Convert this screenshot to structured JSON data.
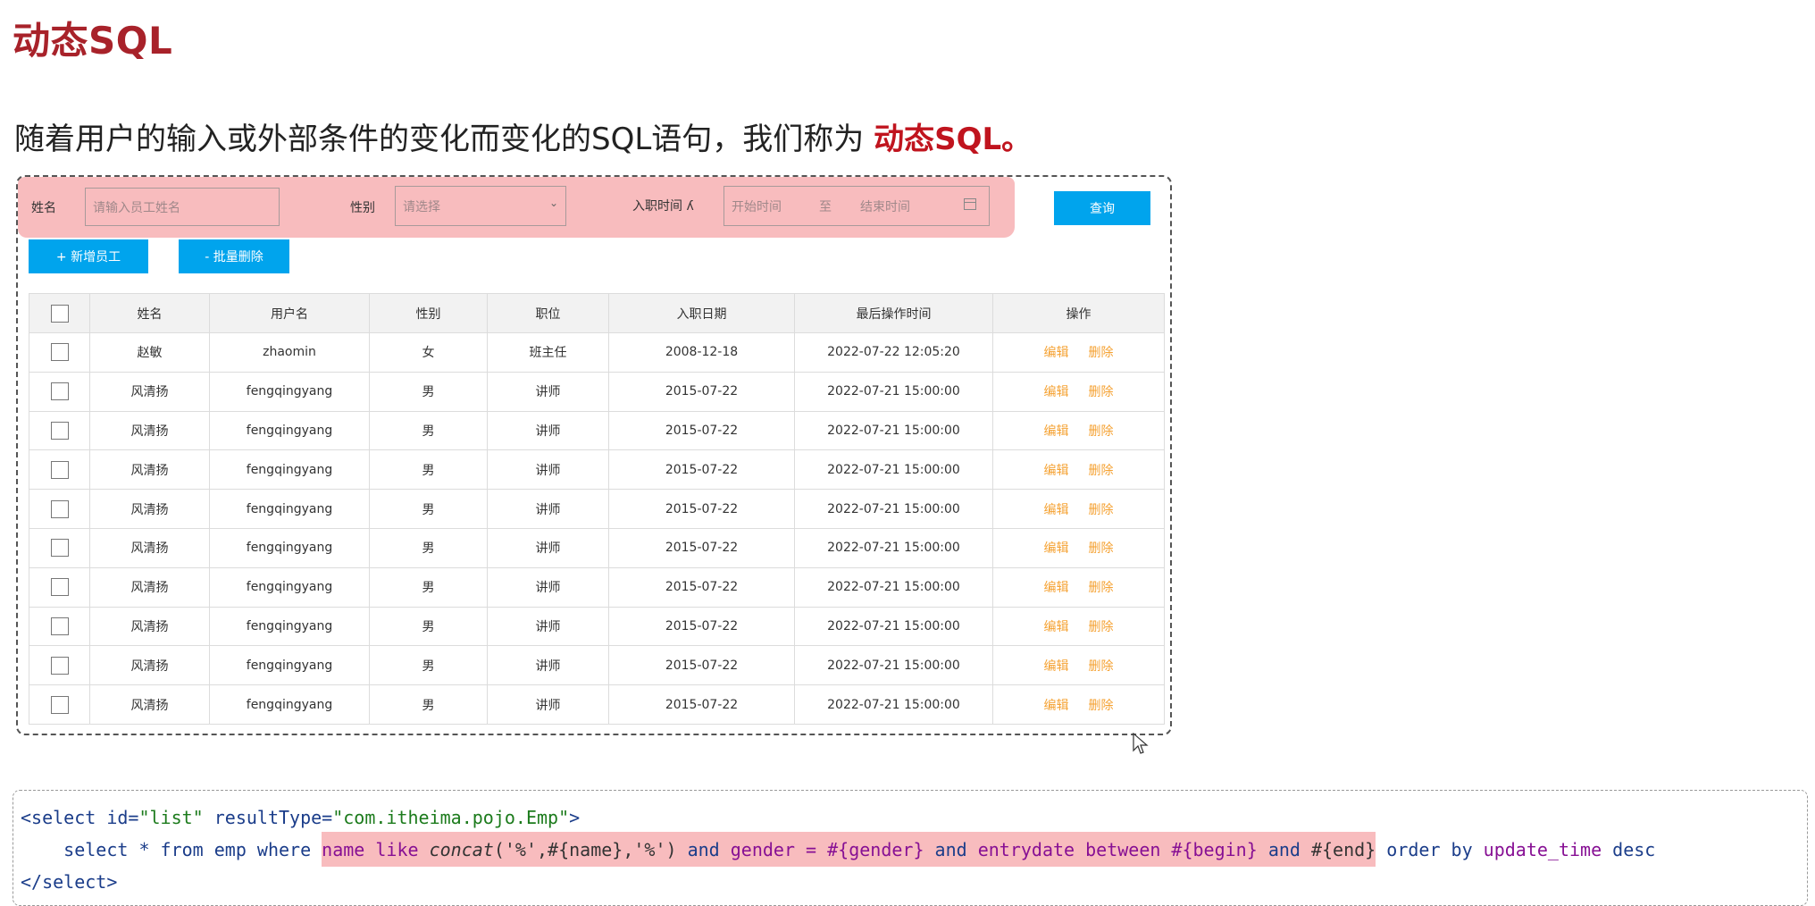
{
  "page": {
    "title": "动态SQL",
    "description_prefix": "随着用户的输入或外部条件的变化而变化的SQL语句，我们称为 ",
    "description_highlight": "动态SQL。"
  },
  "filter": {
    "name_label": "姓名",
    "name_placeholder": "请输入员工姓名",
    "gender_label": "性别",
    "gender_placeholder": "请选择",
    "entry_label": "入职时间",
    "entry_prefix_icon": "ʎ",
    "start_placeholder": "开始时间",
    "range_separator": "至",
    "end_placeholder": "结束时间",
    "query_label": "查询"
  },
  "toolbar": {
    "add_label": "+ 新增员工",
    "batch_delete_label": "- 批量删除"
  },
  "table": {
    "headers": [
      "姓名",
      "用户名",
      "性别",
      "职位",
      "入职日期",
      "最后操作时间",
      "操作"
    ],
    "edit_label": "编辑",
    "delete_label": "删除",
    "rows": [
      [
        "赵敏",
        "zhaomin",
        "女",
        "班主任",
        "2008-12-18",
        "2022-07-22 12:05:20"
      ],
      [
        "风清扬",
        "fengqingyang",
        "男",
        "讲师",
        "2015-07-22",
        "2022-07-21 15:00:00"
      ],
      [
        "风清扬",
        "fengqingyang",
        "男",
        "讲师",
        "2015-07-22",
        "2022-07-21 15:00:00"
      ],
      [
        "风清扬",
        "fengqingyang",
        "男",
        "讲师",
        "2015-07-22",
        "2022-07-21 15:00:00"
      ],
      [
        "风清扬",
        "fengqingyang",
        "男",
        "讲师",
        "2015-07-22",
        "2022-07-21 15:00:00"
      ],
      [
        "风清扬",
        "fengqingyang",
        "男",
        "讲师",
        "2015-07-22",
        "2022-07-21 15:00:00"
      ],
      [
        "风清扬",
        "fengqingyang",
        "男",
        "讲师",
        "2015-07-22",
        "2022-07-21 15:00:00"
      ],
      [
        "风清扬",
        "fengqingyang",
        "男",
        "讲师",
        "2015-07-22",
        "2022-07-21 15:00:00"
      ],
      [
        "风清扬",
        "fengqingyang",
        "男",
        "讲师",
        "2015-07-22",
        "2022-07-21 15:00:00"
      ],
      [
        "风清扬",
        "fengqingyang",
        "男",
        "讲师",
        "2015-07-22",
        "2022-07-21 15:00:00"
      ]
    ]
  },
  "code": {
    "line1_open": "<select ",
    "line1_attr1": "id=",
    "line1_val1": "\"list\"",
    "line1_attr2": " resultType=",
    "line1_val2": "\"com.itheima.pojo.Emp\"",
    "line1_close": ">",
    "line2_indent": "    ",
    "line2_plain": "select * from emp where ",
    "line2_hl1": "name like ",
    "line2_fn": "concat",
    "line2_hl2": "('%',#{name},'%') ",
    "line2_and1": "and",
    "line2_gender": " gender = #{gender} ",
    "line2_and2": "and",
    "line2_entry": " entrydate between #{begin} ",
    "line2_and3": "and",
    "line2_end": " #{end}",
    "line2_order": " order by ",
    "line2_col": "update_time",
    "line2_desc": " desc",
    "line3": "</select>"
  },
  "colors": {
    "title": "#a8222a",
    "highlight": "#f8bcbe",
    "button": "#00a4ed",
    "action": "#f5a233"
  }
}
